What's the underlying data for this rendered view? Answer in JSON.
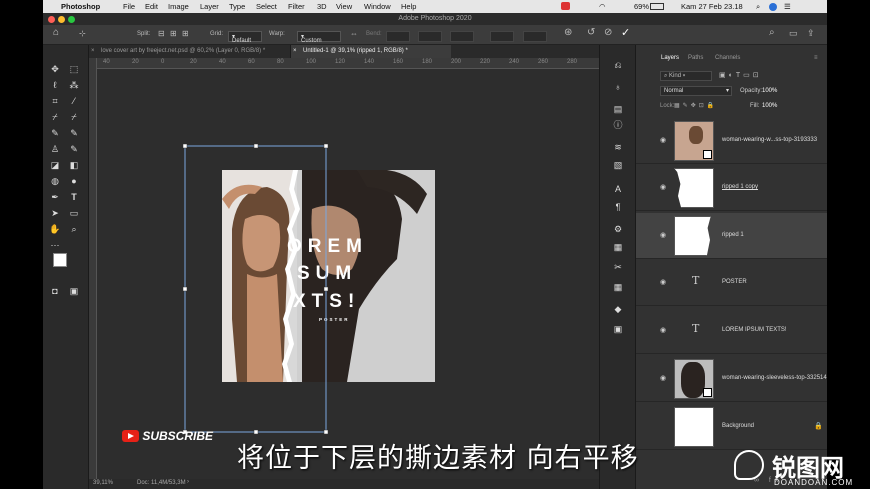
{
  "menubar": {
    "apple": "",
    "app_name": "Photoshop",
    "items": [
      "File",
      "Edit",
      "Image",
      "Layer",
      "Type",
      "Select",
      "Filter",
      "3D",
      "View",
      "Window",
      "Help"
    ],
    "battery": "69%",
    "datetime": "Kam 27 Feb  23.18"
  },
  "window_title": "Adobe Photoshop 2020",
  "options": {
    "split_label": "Split:",
    "grid_label": "Grid:",
    "grid_value": "Default",
    "warp_label": "Warp:",
    "warp_value": "Custom",
    "bend_label": "Bend:"
  },
  "tabs": [
    {
      "label": "love cover art by freeject.net.psd @ 60,2% (Layer 0, RGB/8) *",
      "active": false
    },
    {
      "label": "Untitled-1 @ 39,1% (ripped 1, RGB/8) *",
      "active": true
    }
  ],
  "ruler_top_ticks": [
    "40",
    "20",
    "0",
    "20",
    "40",
    "60",
    "80",
    "100",
    "120",
    "140",
    "160",
    "180",
    "200",
    "220",
    "240",
    "260",
    "280"
  ],
  "canvas": {
    "big_text": [
      "OREM",
      "SUM",
      "XTS!"
    ],
    "small_text": "POSTER"
  },
  "status": {
    "zoom": "39,11%",
    "doc": "Doc: 11,4M/53,3M"
  },
  "layers_panel": {
    "tabs": [
      "Layers",
      "Paths",
      "Channels"
    ],
    "search_placeholder": "Kind",
    "blend_mode": "Normal",
    "opacity_label": "Opacity:",
    "opacity_value": "100%",
    "lock_label": "Lock:",
    "fill_label": "Fill:",
    "fill_value": "100%",
    "layers": [
      {
        "name": "woman-wearing-w...ss-top-3193333",
        "kind": "photo"
      },
      {
        "name": "ripped 1 copy",
        "kind": "paper"
      },
      {
        "name": "ripped 1",
        "kind": "paper",
        "selected": true
      },
      {
        "name": "POSTER",
        "kind": "text"
      },
      {
        "name": "LOREM IPSUM TEXTS!",
        "kind": "text"
      },
      {
        "name": "woman-wearing-sleeveless-top-3325142",
        "kind": "photo2"
      },
      {
        "name": "Background",
        "kind": "bg"
      }
    ]
  },
  "overlay": {
    "subscribe": "SUBSCRIBE",
    "subtitle": "将位于下层的撕边素材 向右平移",
    "watermark_text": "锐图网",
    "watermark_url": "DOANDOAN.COM"
  },
  "colors": {
    "accent_blue": "#4a90e2",
    "selected_layer": "#434343",
    "youtube_red": "#e62117"
  }
}
